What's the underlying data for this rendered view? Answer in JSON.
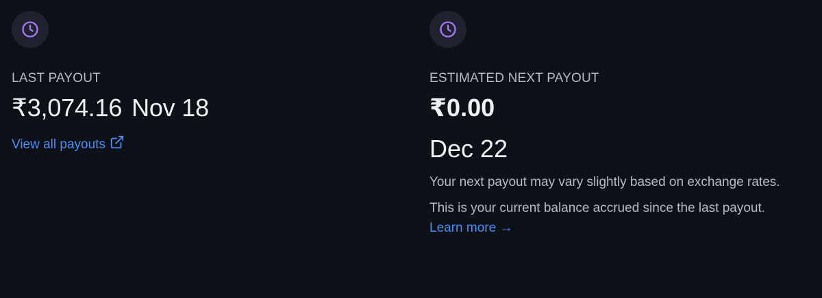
{
  "last_payout": {
    "icon": "clock-icon",
    "label": "LAST PAYOUT",
    "amount": "₹3,074.16",
    "date": "Nov 18",
    "link_label": "View all payouts",
    "link_icon": "external-link-icon"
  },
  "next_payout": {
    "icon": "clock-icon",
    "label": "ESTIMATED NEXT PAYOUT",
    "amount": "₹0.00",
    "date": "Dec 22",
    "note_1": "Your next payout may vary slightly based on exchange rates.",
    "note_2": "This is your current balance accrued since the last payout.",
    "link_label": "Learn more →"
  },
  "colors": {
    "background": "#0e1117",
    "icon_accent": "#a778f7",
    "link": "#4c8df6"
  }
}
